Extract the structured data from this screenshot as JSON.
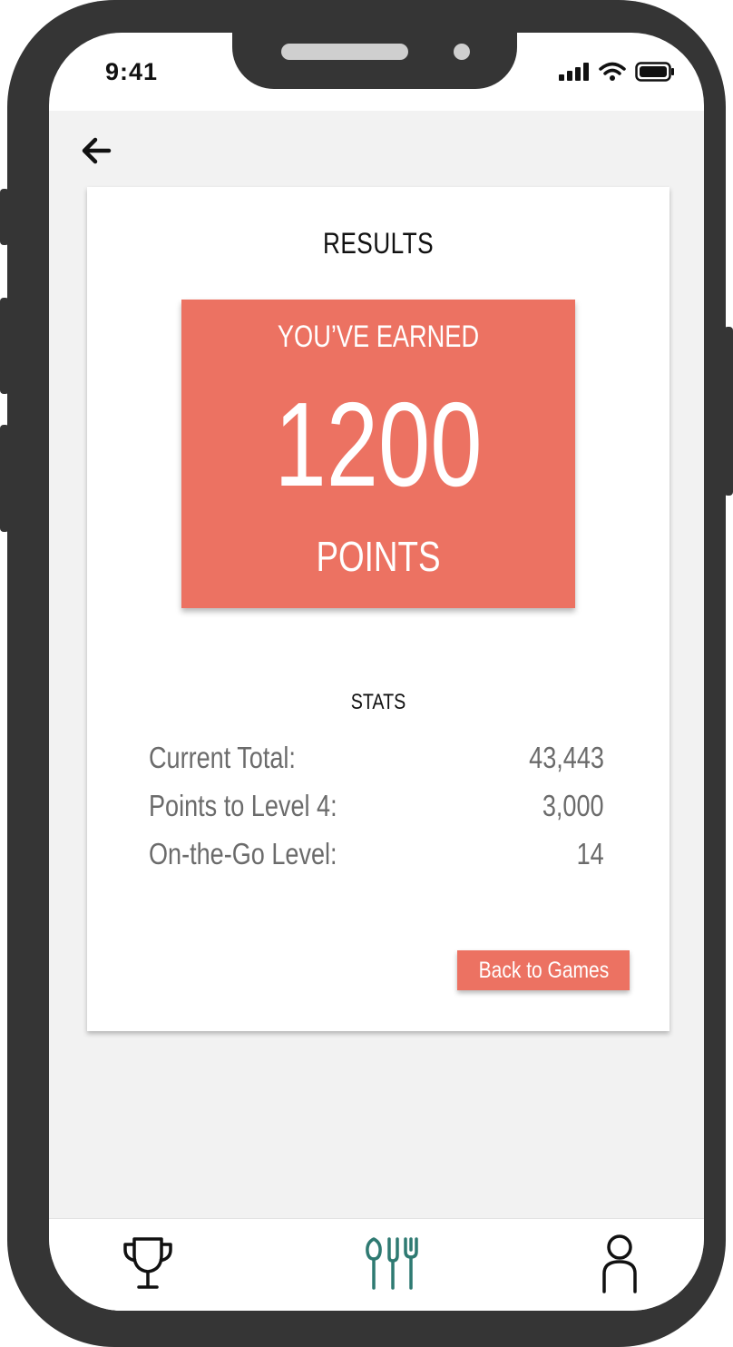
{
  "status_bar": {
    "time": "9:41"
  },
  "nav": {
    "back_icon": "arrow-left-icon"
  },
  "results": {
    "title": "RESULTS",
    "earned_label": "YOU’VE EARNED",
    "points": "1200",
    "points_label": "POINTS"
  },
  "stats": {
    "title": "STATS",
    "rows": [
      {
        "label": "Current Total:",
        "value": "43,443"
      },
      {
        "label": "Points to Level 4:",
        "value": "3,000"
      },
      {
        "label": "On-the-Go Level:",
        "value": "14"
      }
    ]
  },
  "actions": {
    "back_to_games": "Back to Games"
  },
  "tabbar": {
    "tabs": [
      {
        "icon": "trophy-icon",
        "active": false
      },
      {
        "icon": "utensils-icon",
        "active": true
      },
      {
        "icon": "person-icon",
        "active": false
      }
    ]
  },
  "colors": {
    "accent": "#ec7262",
    "active_tab": "#2f7a72",
    "background": "#f2f2f2",
    "phone_frame": "#353535"
  }
}
